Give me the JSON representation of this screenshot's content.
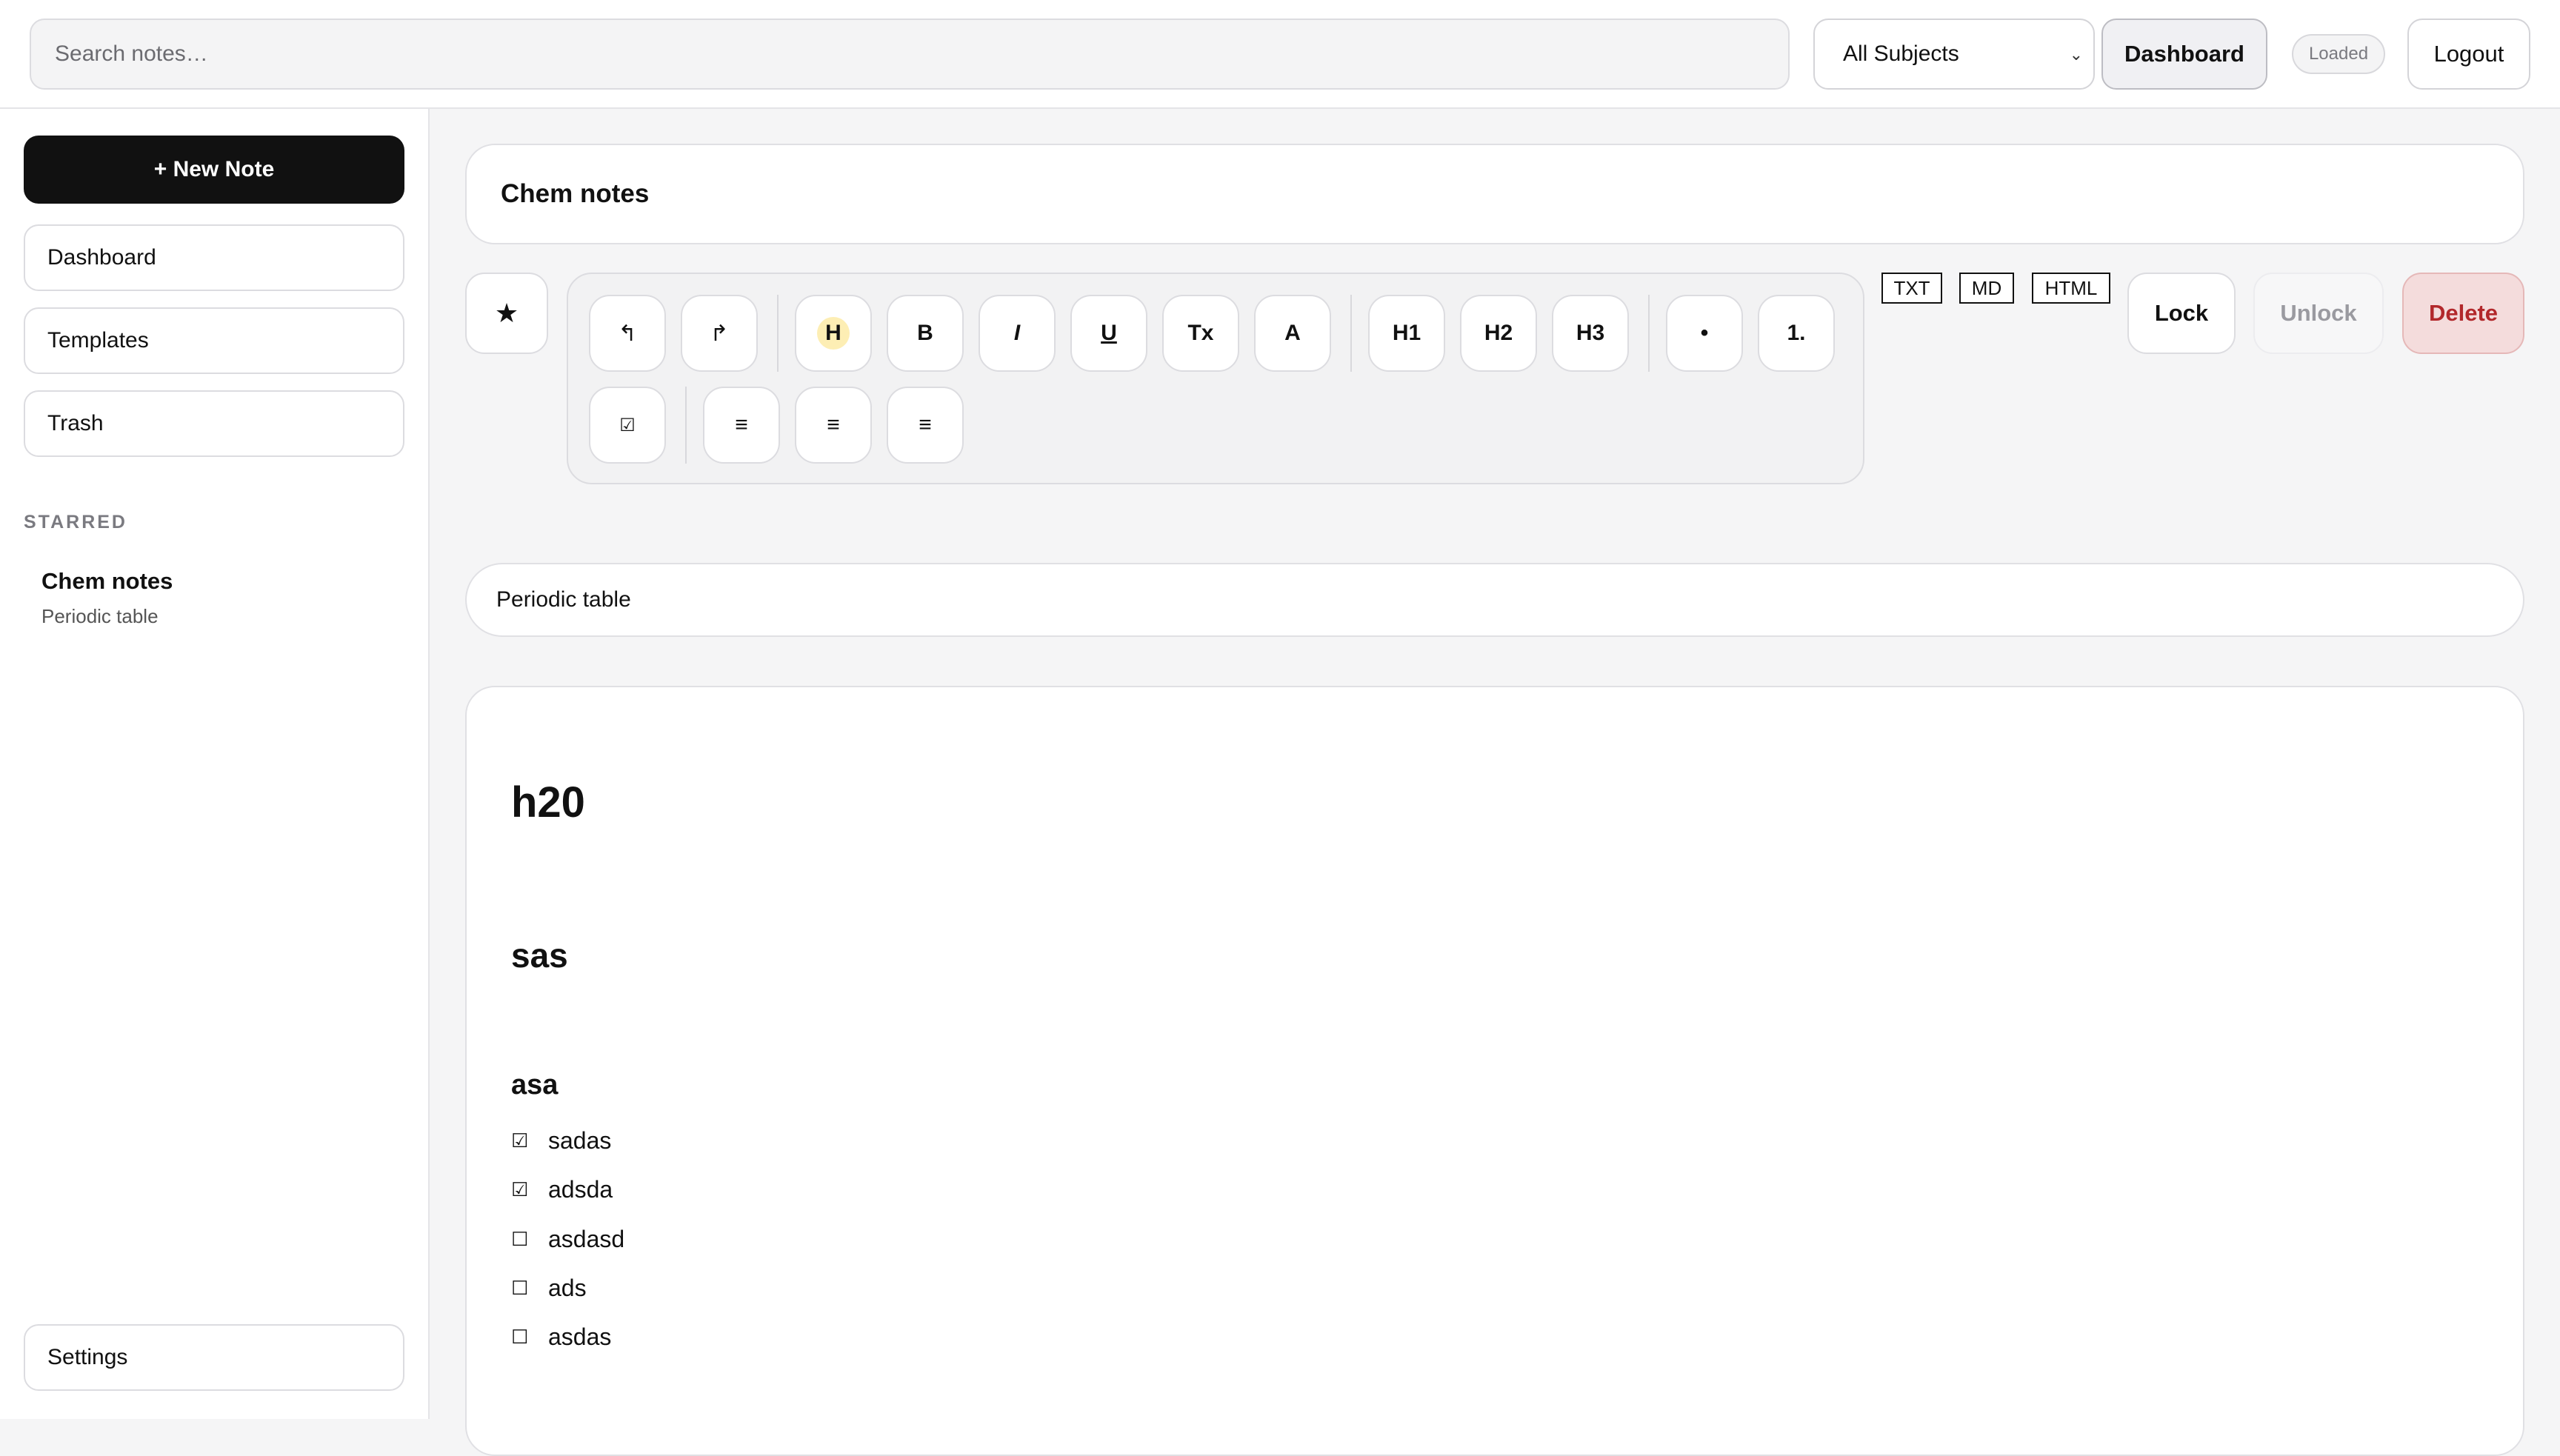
{
  "header": {
    "search_placeholder": "Search notes…",
    "subject_filter": "All Subjects",
    "dashboard_label": "Dashboard",
    "status_badge": "Loaded",
    "logout_label": "Logout"
  },
  "sidebar": {
    "new_note_label": "+ New Note",
    "items": [
      {
        "label": "Dashboard"
      },
      {
        "label": "Templates"
      },
      {
        "label": "Trash"
      }
    ],
    "starred_heading": "STARRED",
    "starred": [
      {
        "title": "Chem notes",
        "subtitle": "Periodic table"
      }
    ],
    "settings_label": "Settings"
  },
  "note": {
    "title": "Chem notes",
    "subtitle": "Periodic table"
  },
  "toolbar": {
    "star": "★",
    "undo": "↰",
    "redo": "↱",
    "highlight": "H",
    "bold": "B",
    "italic": "I",
    "underline": "U",
    "clear_format": "Tx",
    "text_color": "A",
    "h1": "H1",
    "h2": "H2",
    "h3": "H3",
    "bullet_list": "•",
    "ordered_list": "1.",
    "checklist": "☑",
    "align_left": "≡",
    "align_center": "≡",
    "align_right": "≡"
  },
  "export": {
    "txt": "TXT",
    "md": "MD",
    "html": "HTML"
  },
  "actions": {
    "lock": "Lock",
    "unlock": "Unlock",
    "delete": "Delete"
  },
  "content": {
    "heading1": "h20",
    "heading2": "sas",
    "heading3": "asa",
    "checklist": [
      {
        "text": "sadas",
        "checked": true,
        "mark": "☑"
      },
      {
        "text": "adsda",
        "checked": true,
        "mark": "☑"
      },
      {
        "text": "asdasd",
        "checked": false,
        "mark": "☐"
      },
      {
        "text": "ads",
        "checked": false,
        "mark": "☐"
      },
      {
        "text": "asdas",
        "checked": false,
        "mark": "☐"
      }
    ]
  }
}
